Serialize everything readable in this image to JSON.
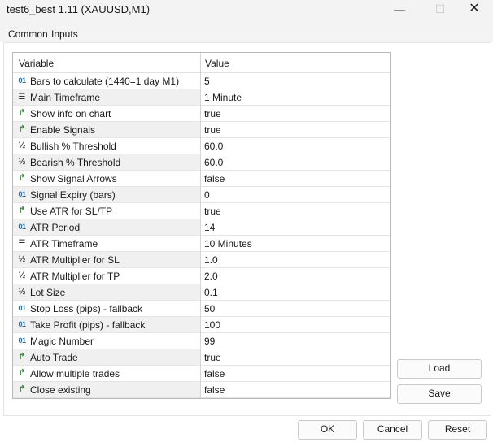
{
  "window": {
    "title": "test6_best 1.11 (XAUUSD,M1)",
    "minimize_glyph": "—",
    "maximize_glyph": "☐",
    "close_glyph": "✕"
  },
  "tabs": [
    {
      "label": "Common",
      "active": false
    },
    {
      "label": "Inputs",
      "active": true
    }
  ],
  "grid": {
    "headers": {
      "variable": "Variable",
      "value": "Value"
    },
    "rows": [
      {
        "type": "int",
        "icon_glyph": "01",
        "label": "Bars to calculate (1440=1 day M1)",
        "value": "5"
      },
      {
        "type": "enum",
        "icon_glyph": "☰",
        "label": "Main Timeframe",
        "value": "1 Minute"
      },
      {
        "type": "bool",
        "icon_glyph": "↱",
        "label": "Show info on chart",
        "value": "true"
      },
      {
        "type": "bool",
        "icon_glyph": "↱",
        "label": "Enable Signals",
        "value": "true"
      },
      {
        "type": "double",
        "icon_glyph": "½",
        "label": "Bullish % Threshold",
        "value": "60.0"
      },
      {
        "type": "double",
        "icon_glyph": "½",
        "label": "Bearish % Threshold",
        "value": "60.0"
      },
      {
        "type": "bool",
        "icon_glyph": "↱",
        "label": "Show Signal Arrows",
        "value": "false"
      },
      {
        "type": "int",
        "icon_glyph": "01",
        "label": "Signal Expiry (bars)",
        "value": "0"
      },
      {
        "type": "bool",
        "icon_glyph": "↱",
        "label": "Use ATR for SL/TP",
        "value": "true"
      },
      {
        "type": "int",
        "icon_glyph": "01",
        "label": "ATR Period",
        "value": "14"
      },
      {
        "type": "enum",
        "icon_glyph": "☰",
        "label": "ATR Timeframe",
        "value": "10 Minutes"
      },
      {
        "type": "double",
        "icon_glyph": "½",
        "label": "ATR Multiplier for SL",
        "value": "1.0"
      },
      {
        "type": "double",
        "icon_glyph": "½",
        "label": "ATR Multiplier for TP",
        "value": "2.0"
      },
      {
        "type": "double",
        "icon_glyph": "½",
        "label": "Lot Size",
        "value": "0.1"
      },
      {
        "type": "int",
        "icon_glyph": "01",
        "label": "Stop Loss (pips) - fallback",
        "value": "50"
      },
      {
        "type": "int",
        "icon_glyph": "01",
        "label": "Take Profit (pips) - fallback",
        "value": "100"
      },
      {
        "type": "int",
        "icon_glyph": "01",
        "label": "Magic Number",
        "value": "99"
      },
      {
        "type": "bool",
        "icon_glyph": "↱",
        "label": "Auto Trade",
        "value": "true"
      },
      {
        "type": "bool",
        "icon_glyph": "↱",
        "label": "Allow multiple trades",
        "value": "false"
      },
      {
        "type": "bool",
        "icon_glyph": "↱",
        "label": "Close existing",
        "value": "false"
      }
    ]
  },
  "buttons": {
    "load": "Load",
    "save": "Save",
    "ok": "OK",
    "cancel": "Cancel",
    "reset": "Reset"
  },
  "colors": {
    "accent": "#1f6fb5",
    "bool_icon": "#2e8b2e",
    "int_icon": "#1f6fb5"
  }
}
